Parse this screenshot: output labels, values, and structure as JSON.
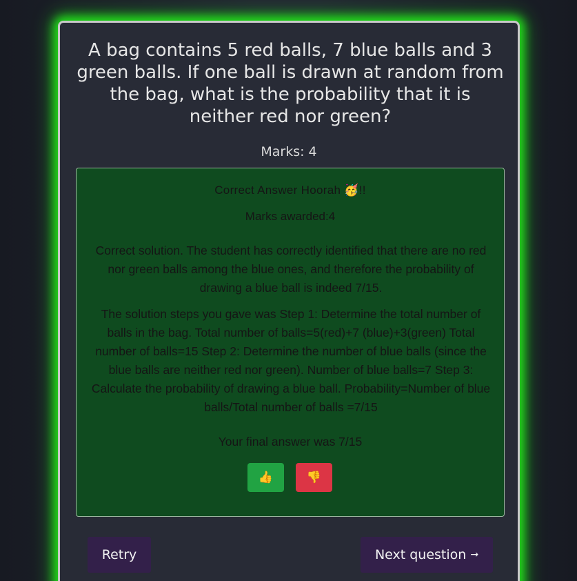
{
  "question": {
    "text": "A bag contains 5 red balls, 7 blue balls and 3 green balls. If one ball is drawn at random from the bag, what is the probability that it is neither red nor green?",
    "marks_label": "Marks: 4"
  },
  "result": {
    "title": "Correct Answer Hoorah 🥳!!",
    "marks_awarded": "Marks awarded:4",
    "feedback": "Correct solution. The student has correctly identified that there are no red nor green balls among the blue ones, and therefore the probability of drawing a blue ball is indeed 7/15.",
    "steps": "The solution steps you gave was Step 1: Determine the total number of balls in the bag. Total number of balls=5(red)+7 (blue)+3(green) Total number of balls=15 Step 2: Determine the number of blue balls (since the blue balls are neither red nor green). Number of blue balls=7 Step 3: Calculate the probability of drawing a blue ball. Probability=Number of blue balls/Total number of balls =7/15",
    "final_answer": "Your final answer was 7/15",
    "thumbs_up_icon": "👍",
    "thumbs_down_icon": "👎"
  },
  "actions": {
    "retry_label": "Retry",
    "next_label": "Next question",
    "next_arrow": "→"
  },
  "colors": {
    "glow": "#22e01a",
    "result_bg": "#0f4b1f",
    "thumb_up": "#21a343",
    "thumb_down": "#dc3545",
    "nav_button": "#33204a"
  }
}
